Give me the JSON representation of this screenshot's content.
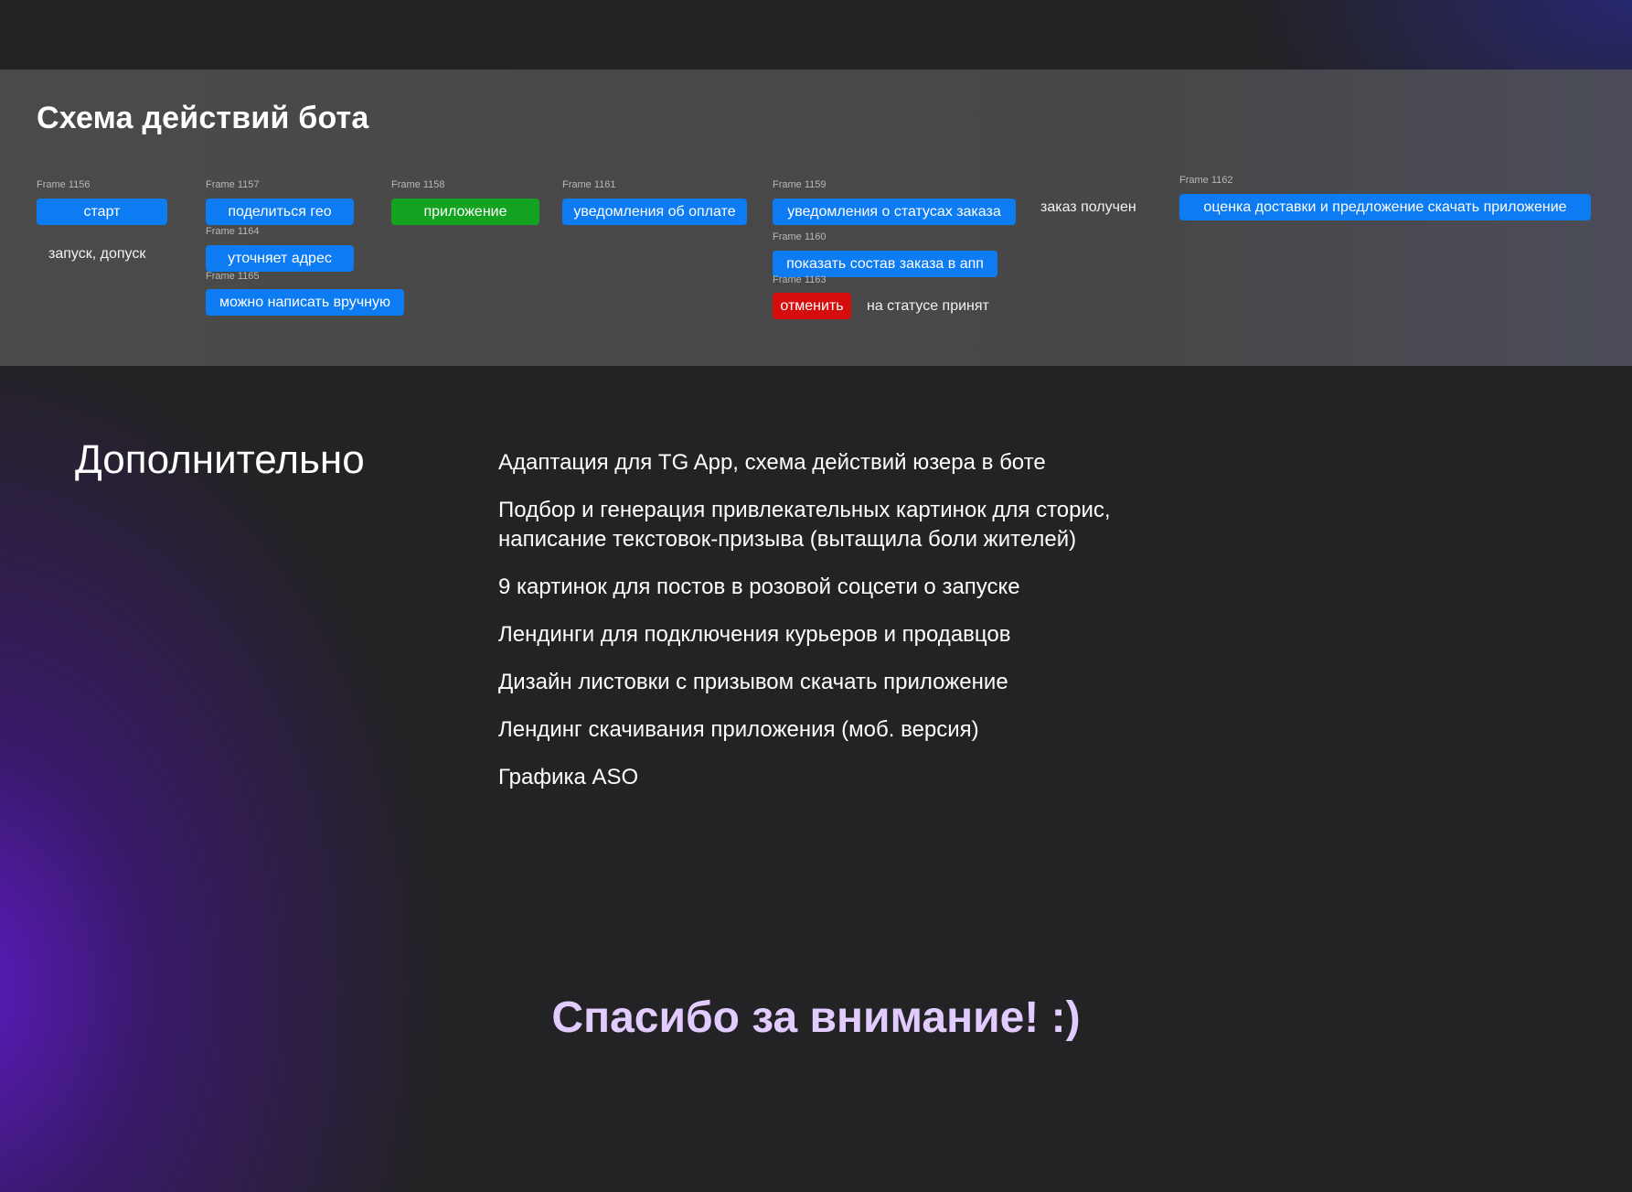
{
  "diagram": {
    "title": "Схема действий бота",
    "frames": [
      {
        "frame": "Frame 1156",
        "label": "старт",
        "color": "#0d7bf2"
      },
      {
        "frame": "Frame 1157",
        "label": "поделиться гео",
        "color": "#0d7bf2"
      },
      {
        "frame": "Frame 1164",
        "label": "уточняет адрес",
        "color": "#0d7bf2"
      },
      {
        "frame": "Frame 1165",
        "label": "можно написать вручную",
        "color": "#0d7bf2"
      },
      {
        "frame": "Frame 1158",
        "label": "приложение",
        "color": "#14a321"
      },
      {
        "frame": "Frame 1161",
        "label": "уведомления об оплате",
        "color": "#0d7bf2"
      },
      {
        "frame": "Frame 1159",
        "label": "уведомления о статусах заказа",
        "color": "#0d7bf2"
      },
      {
        "frame": "Frame 1160",
        "label": "показать состав заказа в апп",
        "color": "#0d7bf2"
      },
      {
        "frame": "Frame 1163",
        "label": "отменить",
        "color": "#d50d0d"
      },
      {
        "frame": "Frame 1162",
        "label": "оценка доставки и предложение скачать приложение",
        "color": "#0d7bf2"
      }
    ],
    "notes": {
      "launch": "запуск, допуск",
      "on_status": "на статусе принят",
      "received": "заказ получен"
    }
  },
  "extra": {
    "heading": "Дополнительно",
    "items": [
      "Адаптация для TG App, схема действий юзера в боте",
      "Подбор и генерация привлекательных картинок для сторис, написание текстовок-призыва (вытащила боли жителей)",
      "9 картинок для постов в розовой соцсети о запуске",
      "Лендинги для подключения курьеров и продавцов",
      "Дизайн листовки с призывом скачать приложение",
      "Лендинг скачивания приложения (моб. версия)",
      "Графика ASO"
    ]
  },
  "closing": "Спасибо за внимание! :)"
}
